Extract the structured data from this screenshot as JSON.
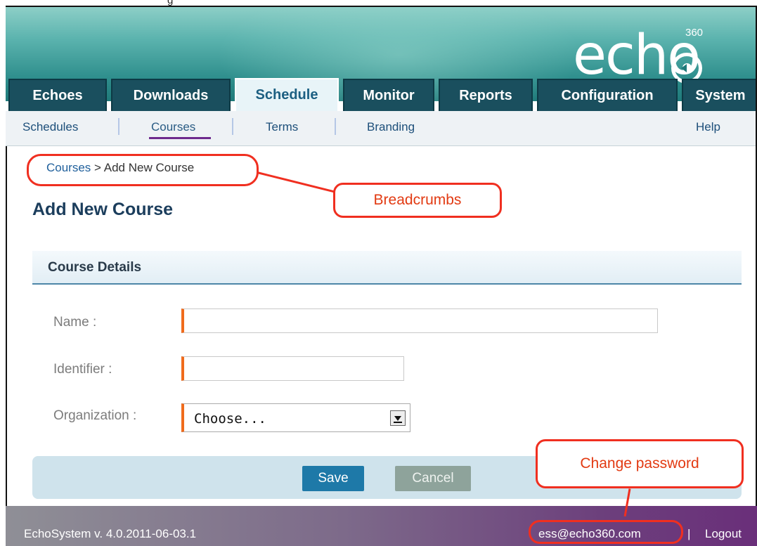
{
  "caption_fragment": "g",
  "logo": {
    "text": "echo",
    "superscript": "360"
  },
  "tabs": [
    {
      "label": "Echoes"
    },
    {
      "label": "Downloads"
    },
    {
      "label": "Schedule",
      "active": true
    },
    {
      "label": "Monitor"
    },
    {
      "label": "Reports"
    },
    {
      "label": "Configuration"
    },
    {
      "label": "System"
    }
  ],
  "subnav": {
    "items": [
      "Schedules",
      "Courses",
      "Terms",
      "Branding"
    ],
    "active": "Courses",
    "help": "Help"
  },
  "breadcrumb": {
    "link": "Courses",
    "current": "> Add New Course"
  },
  "page_title": "Add New Course",
  "section_title": "Course Details",
  "form": {
    "name_label": "Name :",
    "name_value": "",
    "identifier_label": "Identifier :",
    "identifier_value": "",
    "organization_label": "Organization :",
    "organization_value": "Choose..."
  },
  "buttons": {
    "save": "Save",
    "cancel": "Cancel"
  },
  "footer": {
    "version": "EchoSystem v. 4.0.2011-06-03.1",
    "email": "ess@echo360.com",
    "separator": "|",
    "logout": "Logout"
  },
  "annotations": {
    "breadcrumbs": "Breadcrumbs",
    "change_password": "Change password"
  },
  "colors": {
    "tab_bg": "#1a4f5e",
    "tab_active_bg": "#e8f4f8",
    "required_marker": "#f06b1c",
    "save_button": "#1e79a8",
    "annotation_red": "#f02f20",
    "footer_purple": "#6a2f7a"
  }
}
